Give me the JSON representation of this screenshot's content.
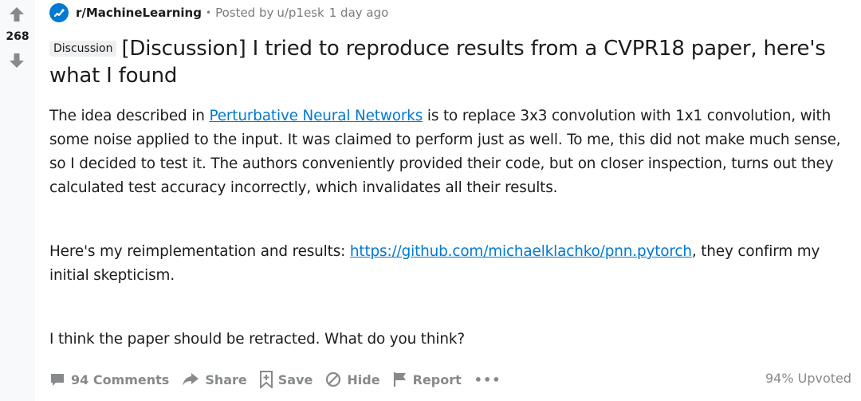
{
  "vote": {
    "count": "268"
  },
  "meta": {
    "subreddit": "r/MachineLearning",
    "separator": "•",
    "posted_by": "Posted by",
    "author": "u/p1esk",
    "age": "1 day ago"
  },
  "post": {
    "flair": "Discussion",
    "title": "[Discussion] I tried to reproduce results from a CVPR18 paper, here's what I found",
    "p1_before_link": "The idea described in ",
    "p1_link": "Perturbative Neural Networks",
    "p1_after_link": " is to replace 3x3 convolution with 1x1 convolution, with some noise applied to the input. It was claimed to perform just as well. To me, this did not make much sense, so I decided to test it. The authors conveniently provided their code, but on closer inspection, turns out they calculated test accuracy incorrectly, which invalidates all their results.",
    "p2_before_link": "Here's my reimplementation and results: ",
    "p2_link": "https://github.com/michaelklachko/pnn.pytorch",
    "p2_after_link": ", they confirm my initial skepticism.",
    "p3": "I think the paper should be retracted. What do you think?"
  },
  "actions": {
    "comments": "94 Comments",
    "share": "Share",
    "save": "Save",
    "hide": "Hide",
    "report": "Report",
    "more": "•••",
    "upvoted": "94% Upvoted"
  },
  "colors": {
    "icon_gray": "#878a8c",
    "subreddit_blue": "#0079d3",
    "link_blue": "#0079d3"
  },
  "icons": [
    "upvote-arrow",
    "downvote-arrow",
    "subreddit-icon",
    "comment-icon",
    "share-icon",
    "save-icon",
    "hide-icon",
    "report-icon"
  ]
}
